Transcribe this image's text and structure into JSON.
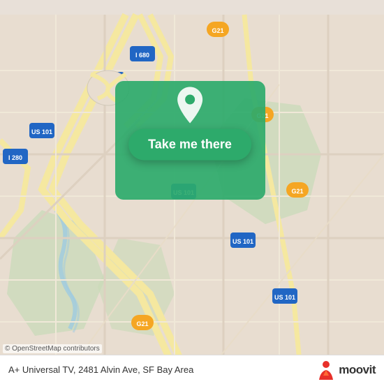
{
  "map": {
    "background_color": "#e8ddd0",
    "attribution": "© OpenStreetMap contributors"
  },
  "button": {
    "label": "Take me there",
    "bg_color": "#2daa6b"
  },
  "bottom_bar": {
    "address": "A+ Universal TV, 2481 Alvin Ave, SF Bay Area",
    "logo_text": "moovit"
  }
}
